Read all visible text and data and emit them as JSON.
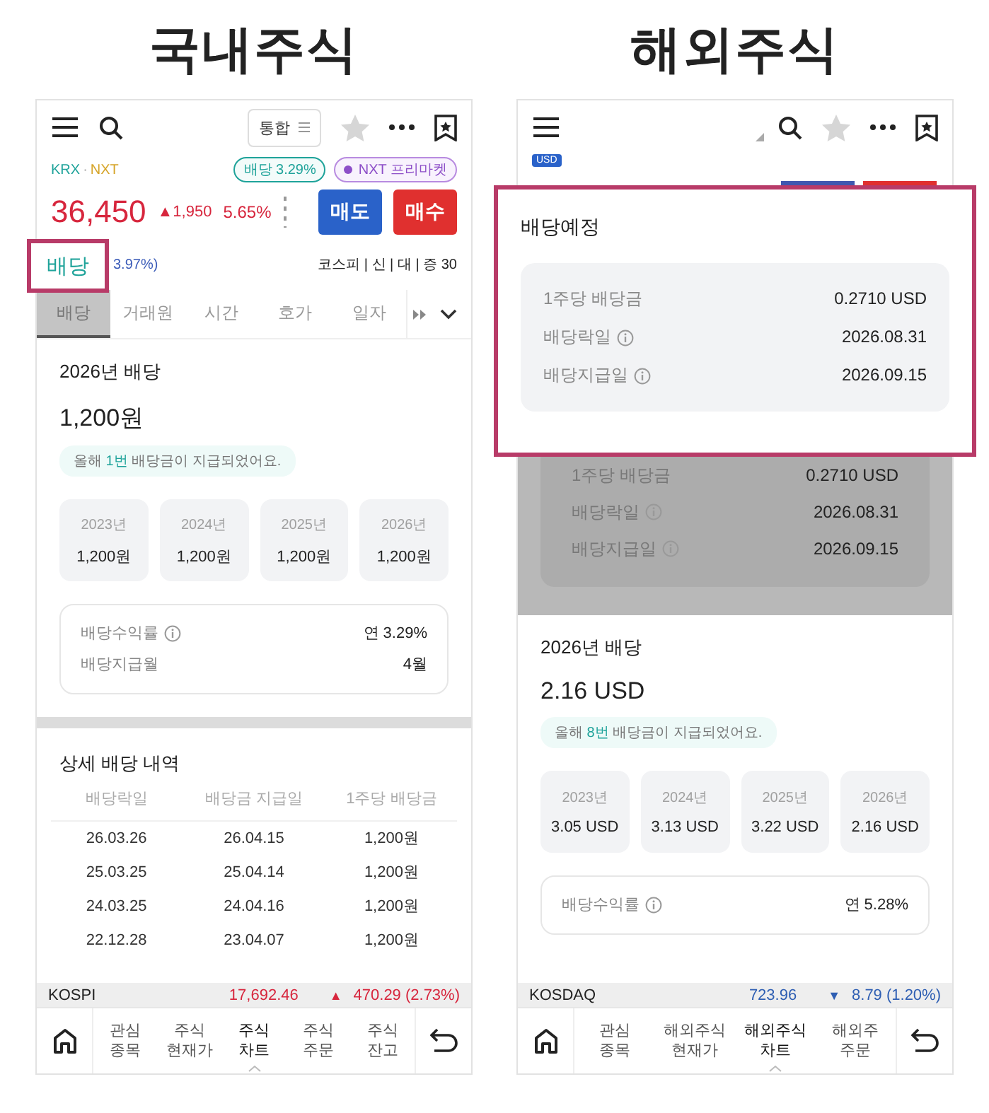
{
  "panels": [
    {
      "title": "국내주식",
      "kind": "domestic",
      "top_bar": {
        "filter_button": "통합"
      },
      "market_separator": "·",
      "markets": [
        {
          "label": "KRX",
          "color": "#1fa39a"
        },
        {
          "label": "NXT",
          "color": "#d6a52a"
        }
      ],
      "badges": [
        {
          "label": "배당 3.29%",
          "kind": "dividend"
        },
        {
          "label": "NXT 프리마켓",
          "kind": "premarket"
        }
      ],
      "price": {
        "value": "36,450",
        "change": "▲1,950",
        "rate": "5.65%",
        "rising": true
      },
      "order_buttons": [
        {
          "label": "매도",
          "kind": "sell"
        },
        {
          "label": "매수",
          "kind": "buy"
        }
      ],
      "sub_rate": "3.97%)",
      "market_info": "코스피 | 신 | 대 | 증 30",
      "tabs": [
        {
          "label": "배당",
          "selected": true
        },
        {
          "label": "거래원",
          "selected": false
        },
        {
          "label": "시간",
          "selected": false
        },
        {
          "label": "호가",
          "selected": false
        },
        {
          "label": "일자",
          "selected": false
        }
      ],
      "callout": {
        "label": "배당"
      },
      "dividend": {
        "title": "2026년 배당",
        "amount": "1,200원",
        "note": {
          "before": "올해 ",
          "count": "1번",
          "after": " 배당금이 지급되었어요."
        },
        "years": [
          {
            "year": "2023년",
            "amount": "1,200원"
          },
          {
            "year": "2024년",
            "amount": "1,200원"
          },
          {
            "year": "2025년",
            "amount": "1,200원"
          },
          {
            "year": "2026년",
            "amount": "1,200원"
          }
        ],
        "summary": [
          {
            "label": "배당수익률",
            "info": true,
            "value": "연 3.29%"
          },
          {
            "label": "배당지급월",
            "info": false,
            "value": "4월"
          }
        ]
      },
      "history": {
        "title": "상세 배당 내역",
        "columns": [
          "배당락일",
          "배당금 지급일",
          "1주당 배당금"
        ],
        "rows": [
          [
            "26.03.26",
            "26.04.15",
            "1,200원"
          ],
          [
            "25.03.25",
            "25.04.14",
            "1,200원"
          ],
          [
            "24.03.25",
            "24.04.16",
            "1,200원"
          ],
          [
            "22.12.28",
            "23.04.07",
            "1,200원"
          ]
        ]
      },
      "index_bar": {
        "name": "KOSPI",
        "value": "17,692.46",
        "arrow": "▲",
        "change": "470.29 (2.73%)",
        "rising": true
      },
      "nav": [
        {
          "lines": [
            "관심",
            "종목"
          ],
          "selected": false
        },
        {
          "lines": [
            "주식",
            "현재가"
          ],
          "selected": false
        },
        {
          "lines": [
            "주식",
            "차트"
          ],
          "selected": true
        },
        {
          "lines": [
            "주식",
            "주문"
          ],
          "selected": false
        },
        {
          "lines": [
            "주식",
            "잔고"
          ],
          "selected": false
        }
      ]
    },
    {
      "title": "해외주식",
      "kind": "overseas",
      "currency_badge": "USD",
      "callout": {
        "title": "배당예정",
        "rows": [
          {
            "label": "1주당 배당금",
            "info": false,
            "value": "0.2710 USD"
          },
          {
            "label": "배당락일",
            "info": true,
            "value": "2026.08.31"
          },
          {
            "label": "배당지급일",
            "info": true,
            "value": "2026.09.15"
          }
        ]
      },
      "dimmed_rows": [
        {
          "label": "1주당 배당금",
          "info": false,
          "value": "0.2710 USD"
        },
        {
          "label": "배당락일",
          "info": true,
          "value": "2026.08.31"
        },
        {
          "label": "배당지급일",
          "info": true,
          "value": "2026.09.15"
        }
      ],
      "dividend": {
        "title": "2026년 배당",
        "amount": "2.16 USD",
        "note": {
          "before": "올해 ",
          "count": "8번",
          "after": " 배당금이 지급되었어요."
        },
        "years": [
          {
            "year": "2023년",
            "amount": "3.05 USD"
          },
          {
            "year": "2024년",
            "amount": "3.13 USD"
          },
          {
            "year": "2025년",
            "amount": "3.22 USD"
          },
          {
            "year": "2026년",
            "amount": "2.16 USD"
          }
        ],
        "summary": [
          {
            "label": "배당수익률",
            "info": true,
            "value": "연 5.28%"
          }
        ]
      },
      "index_bar": {
        "name": "KOSDAQ",
        "value": "723.96",
        "arrow": "▼",
        "change": "8.79 (1.20%)",
        "rising": false
      },
      "nav": [
        {
          "lines": [
            "관심",
            "종목"
          ],
          "selected": false
        },
        {
          "lines": [
            "해외주식",
            "현재가"
          ],
          "selected": false
        },
        {
          "lines": [
            "해외주식",
            "차트"
          ],
          "selected": true
        },
        {
          "lines": [
            "해외주",
            "주문"
          ],
          "selected": false
        }
      ]
    }
  ]
}
